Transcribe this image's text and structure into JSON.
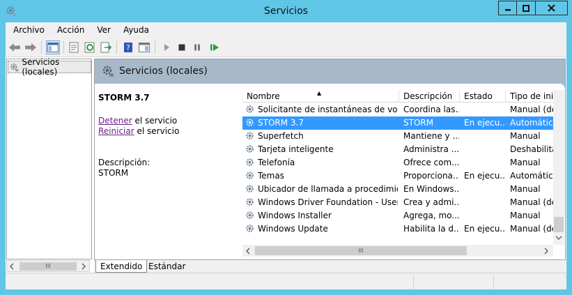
{
  "window": {
    "title": "Servicios"
  },
  "menu": [
    "Archivo",
    "Acción",
    "Ver",
    "Ayuda"
  ],
  "tree": {
    "item": "Servicios (locales)"
  },
  "header": {
    "title": "Servicios (locales)"
  },
  "details": {
    "service_name": "STORM 3.7",
    "stop_link": "Detener",
    "stop_suffix": " el servicio",
    "restart_link": "Reiniciar",
    "restart_suffix": " el servicio",
    "description_label": "Descripción:",
    "description_value": "STORM"
  },
  "list": {
    "columns": [
      "Nombre",
      "Descripción",
      "Estado",
      "Tipo de inic"
    ],
    "rows": [
      [
        "Solicitante de instantáneas de volu...",
        "Coordina las...",
        "",
        "Manual (des"
      ],
      [
        "STORM 3.7",
        "STORM",
        "En ejecu...",
        "Automático"
      ],
      [
        "Superfetch",
        "Mantiene y ...",
        "",
        "Manual"
      ],
      [
        "Tarjeta inteligente",
        "Administra ...",
        "",
        "Deshabilitad"
      ],
      [
        "Telefonía",
        "Ofrece com...",
        "",
        "Manual"
      ],
      [
        "Temas",
        "Proporciona...",
        "En ejecu...",
        "Automático"
      ],
      [
        "Ubicador de llamada a procedimient...",
        "En Windows...",
        "",
        "Manual"
      ],
      [
        "Windows Driver Foundation - User-...",
        "Crea y admi...",
        "",
        "Manual (des"
      ],
      [
        "Windows Installer",
        "Agrega, mo...",
        "",
        "Manual"
      ],
      [
        "Windows Update",
        "Habilita la d...",
        "En ejecu...",
        "Manual (des"
      ]
    ],
    "selected_index": 1
  },
  "tabs": [
    "Extendido",
    "Estándar"
  ],
  "scroll": {
    "h_thumb": "III"
  },
  "colors": {
    "titlebar": "#5fc6e8",
    "selection": "#3399ff",
    "header": "#a7b8c9",
    "link": "#6b1f8a"
  }
}
